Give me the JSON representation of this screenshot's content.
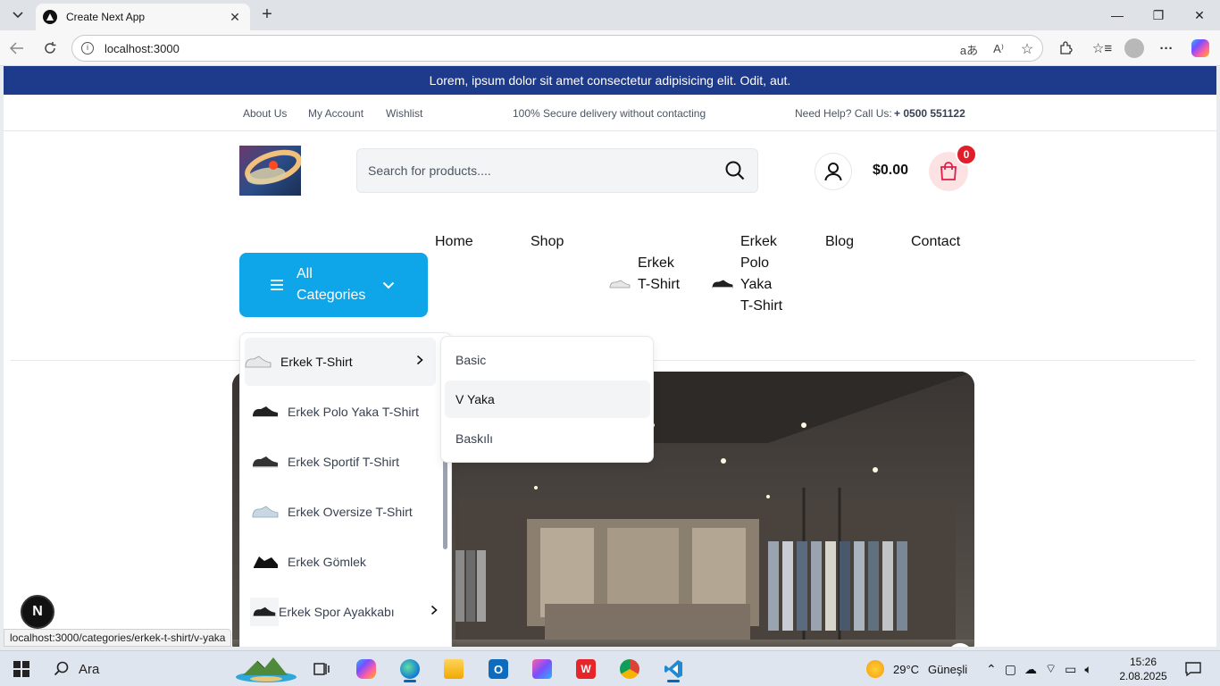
{
  "browser": {
    "tab_title": "Create Next App",
    "url": "localhost:3000",
    "status_url": "localhost:3000/categories/erkek-t-shirt/v-yaka"
  },
  "announcement": "Lorem, ipsum dolor sit amet consectetur adipisicing elit. Odit, aut.",
  "topbar": {
    "links": [
      "About Us",
      "My Account",
      "Wishlist"
    ],
    "secure": "100% Secure delivery without contacting",
    "help_label": "Need Help? Call Us:",
    "phone": "+ 0500 551122"
  },
  "header": {
    "search_placeholder": "Search for products....",
    "cart_total": "$0.00",
    "cart_count": "0"
  },
  "all_categories_label": "All Categories",
  "nav": {
    "home": "Home",
    "shop": "Shop",
    "erkek_tshirt": "Erkek T-Shirt",
    "erkek_polo": "Erkek Polo Yaka T-Shirt",
    "blog": "Blog",
    "contact": "Contact"
  },
  "dropdown": {
    "items": [
      {
        "label": "Erkek T-Shirt"
      },
      {
        "label": "Erkek Polo Yaka T-Shirt"
      },
      {
        "label": "Erkek Sportif T-Shirt"
      },
      {
        "label": "Erkek Oversize T-Shirt"
      },
      {
        "label": "Erkek Gömlek"
      },
      {
        "label": "Erkek Spor Ayakkabı"
      }
    ]
  },
  "submenu": {
    "items": [
      {
        "label": "Basic"
      },
      {
        "label": "V Yaka"
      },
      {
        "label": "Baskılı"
      }
    ]
  },
  "next_badge": "N",
  "taskbar": {
    "search_label": "Ara",
    "weather_temp": "29°C",
    "weather_desc": "Güneşli",
    "time": "15:26",
    "date": "2.08.2025"
  },
  "colors": {
    "announcement_bg": "#1e3a8a",
    "accent": "#0ea5e9",
    "cart_badge": "#e11d2a"
  }
}
